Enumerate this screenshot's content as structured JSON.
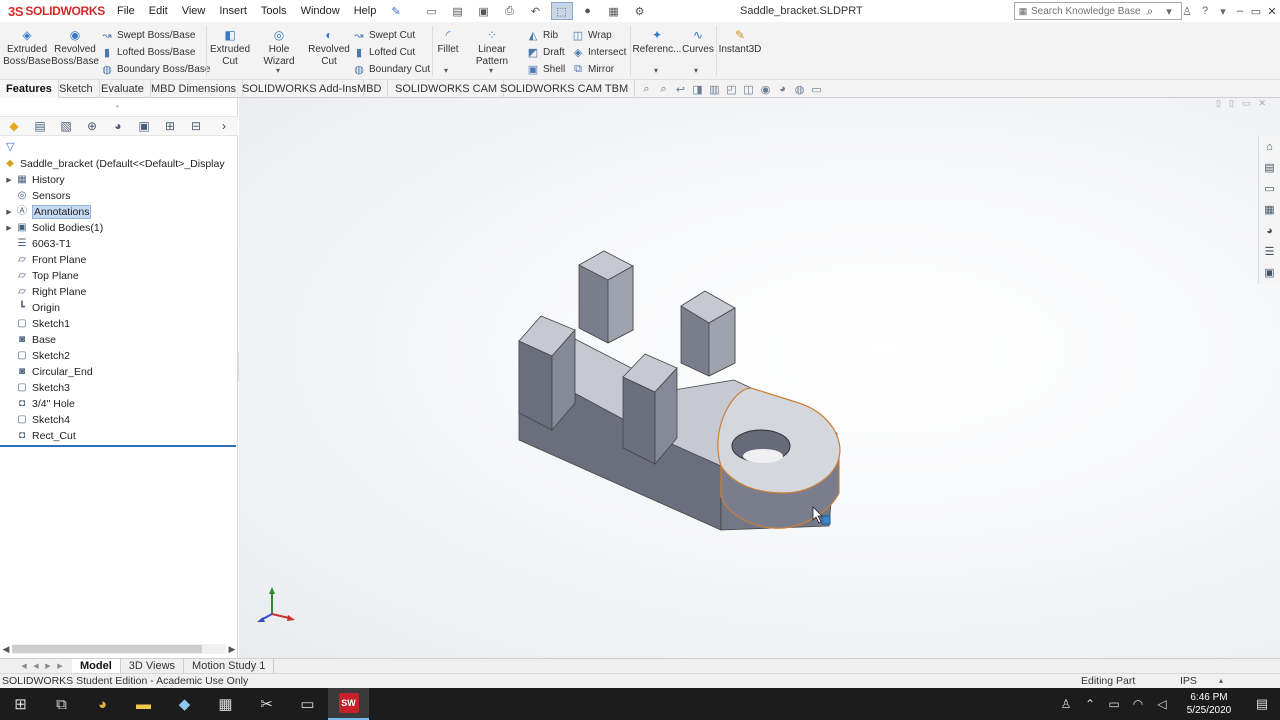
{
  "app": {
    "brand": "SOLIDWORKS",
    "brand_prefix": "3S",
    "document_title": "Saddle_bracket.SLDPRT"
  },
  "menu": [
    "File",
    "Edit",
    "View",
    "Insert",
    "Tools",
    "Window",
    "Help"
  ],
  "search": {
    "placeholder": "Search Knowledge Base"
  },
  "command_manager": {
    "extruded_boss": "Extruded Boss/Base",
    "revolved_boss": "Revolved Boss/Base",
    "swept_boss": "Swept Boss/Base",
    "lofted_boss": "Lofted Boss/Base",
    "boundary_boss": "Boundary Boss/Base",
    "extruded_cut": "Extruded Cut",
    "hole_wizard": "Hole Wizard",
    "revolved_cut": "Revolved Cut",
    "swept_cut": "Swept Cut",
    "lofted_cut": "Lofted Cut",
    "boundary_cut": "Boundary Cut",
    "fillet": "Fillet",
    "linear_pattern": "Linear Pattern",
    "rib": "Rib",
    "draft": "Draft",
    "shell": "Shell",
    "wrap": "Wrap",
    "intersect": "Intersect",
    "mirror": "Mirror",
    "reference": "Referenc...",
    "curves": "Curves",
    "instant3d": "Instant3D"
  },
  "tabs": [
    "Features",
    "Sketch",
    "Evaluate",
    "MBD Dimensions",
    "SOLIDWORKS Add-Ins",
    "MBD",
    "SOLIDWORKS CAM",
    "SOLIDWORKS CAM TBM"
  ],
  "tree": {
    "root": "Saddle_bracket  (Default<<Default>_Display S",
    "items": [
      {
        "label": "History",
        "icon": "history-icon",
        "expandable": true
      },
      {
        "label": "Sensors",
        "icon": "sensors-icon",
        "expandable": false
      },
      {
        "label": "Annotations",
        "icon": "annotations-icon",
        "expandable": true,
        "selected": true
      },
      {
        "label": "Solid Bodies(1)",
        "icon": "solid-bodies-icon",
        "expandable": true
      },
      {
        "label": "6063-T1",
        "icon": "material-icon",
        "expandable": false
      },
      {
        "label": "Front Plane",
        "icon": "plane-icon",
        "expandable": false
      },
      {
        "label": "Top Plane",
        "icon": "plane-icon",
        "expandable": false
      },
      {
        "label": "Right Plane",
        "icon": "plane-icon",
        "expandable": false
      },
      {
        "label": "Origin",
        "icon": "origin-icon",
        "expandable": false
      },
      {
        "label": "Sketch1",
        "icon": "sketch-icon",
        "expandable": false
      },
      {
        "label": "Base",
        "icon": "extrude-icon",
        "expandable": false
      },
      {
        "label": "Sketch2",
        "icon": "sketch-icon",
        "expandable": false
      },
      {
        "label": "Circular_End",
        "icon": "extrude-icon",
        "expandable": false
      },
      {
        "label": "Sketch3",
        "icon": "sketch-icon",
        "expandable": false
      },
      {
        "label": "3/4\" Hole",
        "icon": "cut-icon",
        "expandable": false
      },
      {
        "label": "Sketch4",
        "icon": "sketch-icon",
        "expandable": false
      },
      {
        "label": "Rect_Cut",
        "icon": "cut-icon",
        "expandable": false
      }
    ]
  },
  "bottom_tabs": [
    "Model",
    "3D Views",
    "Motion Study 1"
  ],
  "status": {
    "left": "SOLIDWORKS Student Edition - Academic Use Only",
    "editing": "Editing Part",
    "units": "IPS"
  },
  "clock": {
    "time": "6:46 PM",
    "date": "5/25/2020"
  },
  "sw_badge": "SW",
  "colors": {
    "brand_red": "#d42a2a",
    "selection_blue": "#c5d9f0",
    "model_gray": "#8c919c",
    "edge_highlight": "#e08a3c",
    "taskbar": "#1c1c1c"
  }
}
